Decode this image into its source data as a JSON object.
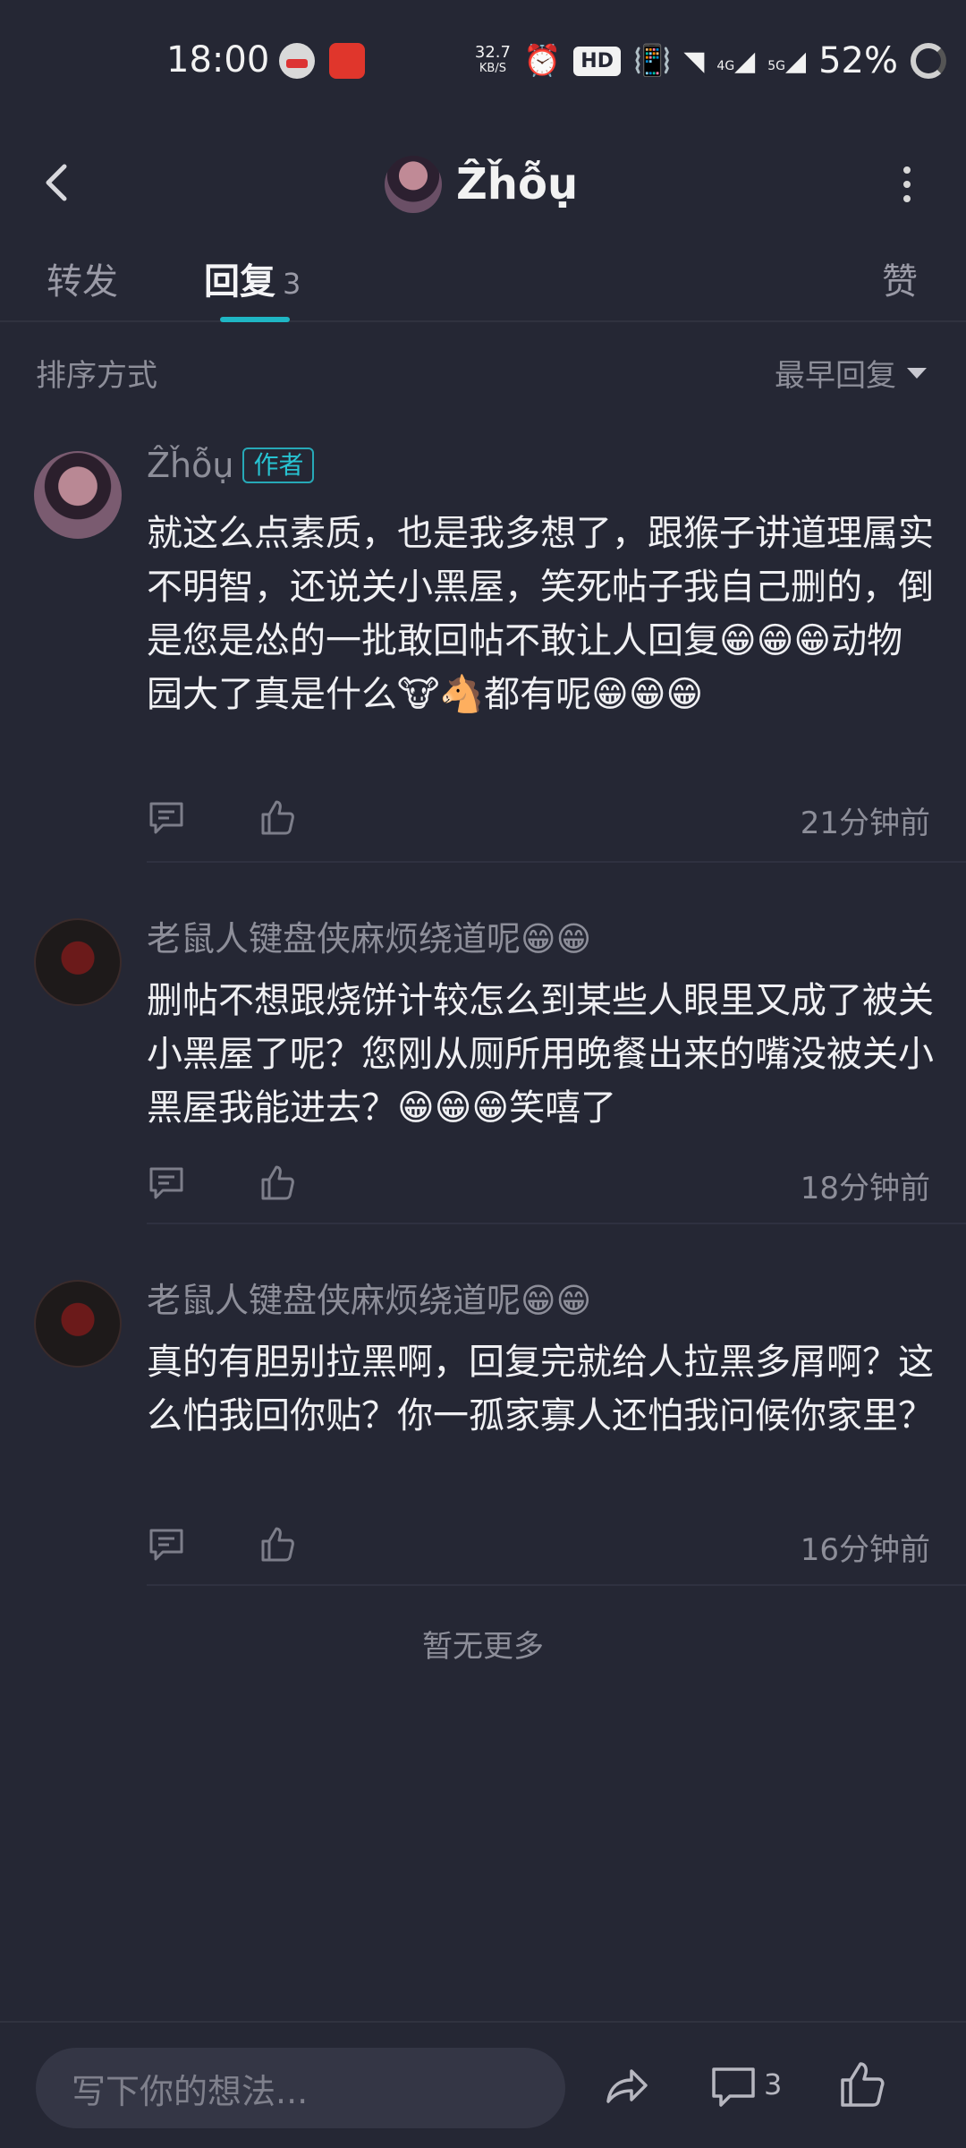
{
  "status_bar": {
    "time": "18:00",
    "net_speed": "32.7",
    "net_unit": "KB/S",
    "hd_label": "HD",
    "network_4g": "4G",
    "network_5g": "5G",
    "battery": "52%"
  },
  "header": {
    "title": "Ẑȟỗụ"
  },
  "tabs": {
    "forward": "转发",
    "reply": "回复",
    "reply_count": "3",
    "like": "赞"
  },
  "sort": {
    "label": "排序方式",
    "value": "最早回复"
  },
  "comments": [
    {
      "name": "Ẑȟỗụ",
      "badge": "作者",
      "text": "就这么点素质，也是我多想了，跟猴子讲道理属实不明智，还说关小黑屋，笑死帖子我自己删的，倒是您是怂的一批敢回帖不敢让人回复😁😁😁动物园大了真是什么🐮🐴都有呢😁😁😁",
      "time": "21分钟前"
    },
    {
      "name": "老鼠人键盘侠麻烦绕道呢😁😁",
      "text": "删帖不想跟烧饼计较怎么到某些人眼里又成了被关小黑屋了呢？您刚从厕所用晚餐出来的嘴没被关小黑屋我能进去？😁😁😁笑嘻了",
      "time": "18分钟前"
    },
    {
      "name": "老鼠人键盘侠麻烦绕道呢😁😁",
      "text": "真的有胆别拉黑啊，回复完就给人拉黑多屑啊？这么怕我回你贴？你一孤家寡人还怕我问候你家里？",
      "time": "16分钟前"
    }
  ],
  "no_more": "暂无更多",
  "bottom": {
    "placeholder": "写下你的想法...",
    "comment_count": "3"
  }
}
